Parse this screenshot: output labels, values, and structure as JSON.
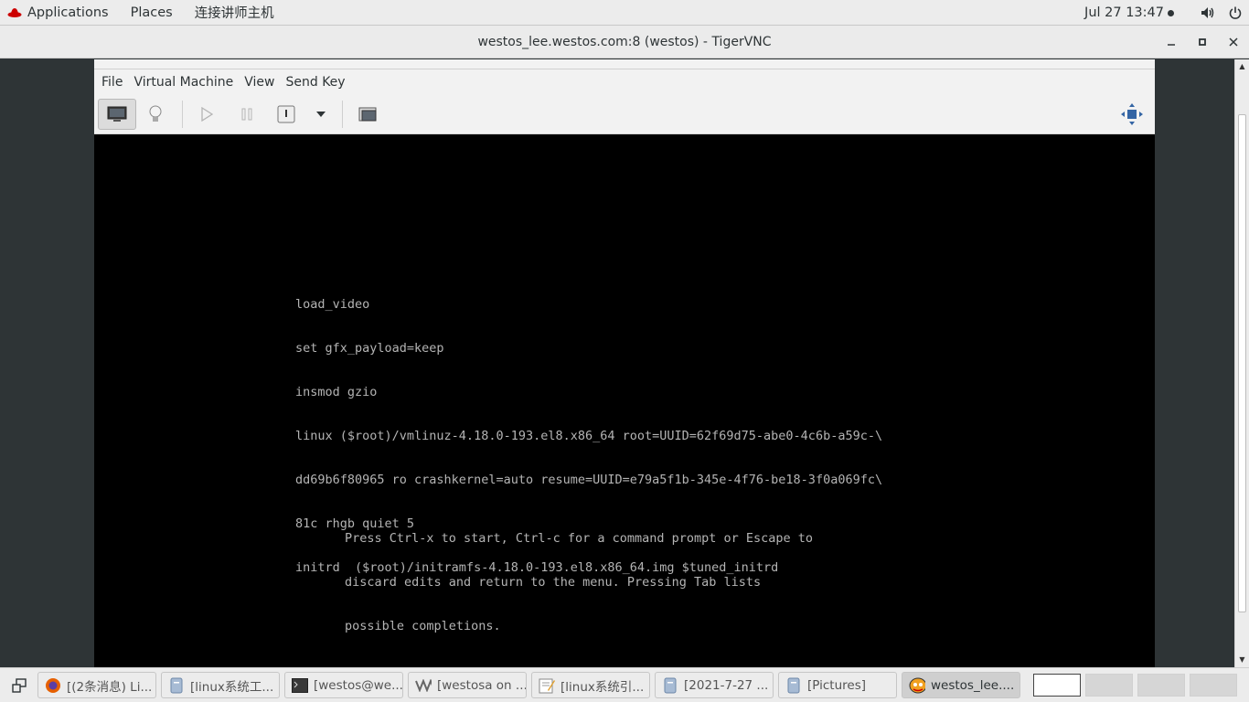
{
  "top_panel": {
    "applications": "Applications",
    "places": "Places",
    "custom_menu": "连接讲师主机",
    "clock": "Jul 27  13:47"
  },
  "window": {
    "title": "westos_lee.westos.com:8 (westos) - TigerVNC"
  },
  "vm": {
    "menu": [
      "File",
      "Virtual Machine",
      "View",
      "Send Key"
    ],
    "console_lines": [
      "load_video",
      "set gfx_payload=keep",
      "insmod gzio",
      "linux ($root)/vmlinuz-4.18.0-193.el8.x86_64 root=UUID=62f69d75-abe0-4c6b-a59c-\\",
      "dd69b6f80965 ro crashkernel=auto resume=UUID=e79a5f1b-345e-4f76-be18-3f0a069fc\\",
      "81c rhgb quiet 5",
      "initrd  ($root)/initramfs-4.18.0-193.el8.x86_64.img $tuned_initrd"
    ],
    "help_lines": [
      "Press Ctrl-x to start, Ctrl-c for a command prompt or Escape to",
      "discard edits and return to the menu. Pressing Tab lists",
      "possible completions."
    ]
  },
  "taskbar": {
    "tasks": [
      {
        "label": "[(2条消息) Li...",
        "icon": "firefox-icon"
      },
      {
        "label": "[linux系统工...",
        "icon": "file-manager-icon"
      },
      {
        "label": "[westos@we...",
        "icon": "terminal-icon"
      },
      {
        "label": "[westosa on ...",
        "icon": "virt-viewer-icon"
      },
      {
        "label": "[linux系统引...",
        "icon": "text-editor-icon"
      },
      {
        "label": "[2021-7-27 ...",
        "icon": "file-manager-icon"
      },
      {
        "label": "[Pictures]",
        "icon": "file-manager-icon"
      },
      {
        "label": "westos_lee....",
        "icon": "tigervnc-icon"
      }
    ]
  },
  "colors": {
    "console_text": "#b4b4b4",
    "console_bg": "#000000",
    "panel_bg": "#ececec"
  }
}
